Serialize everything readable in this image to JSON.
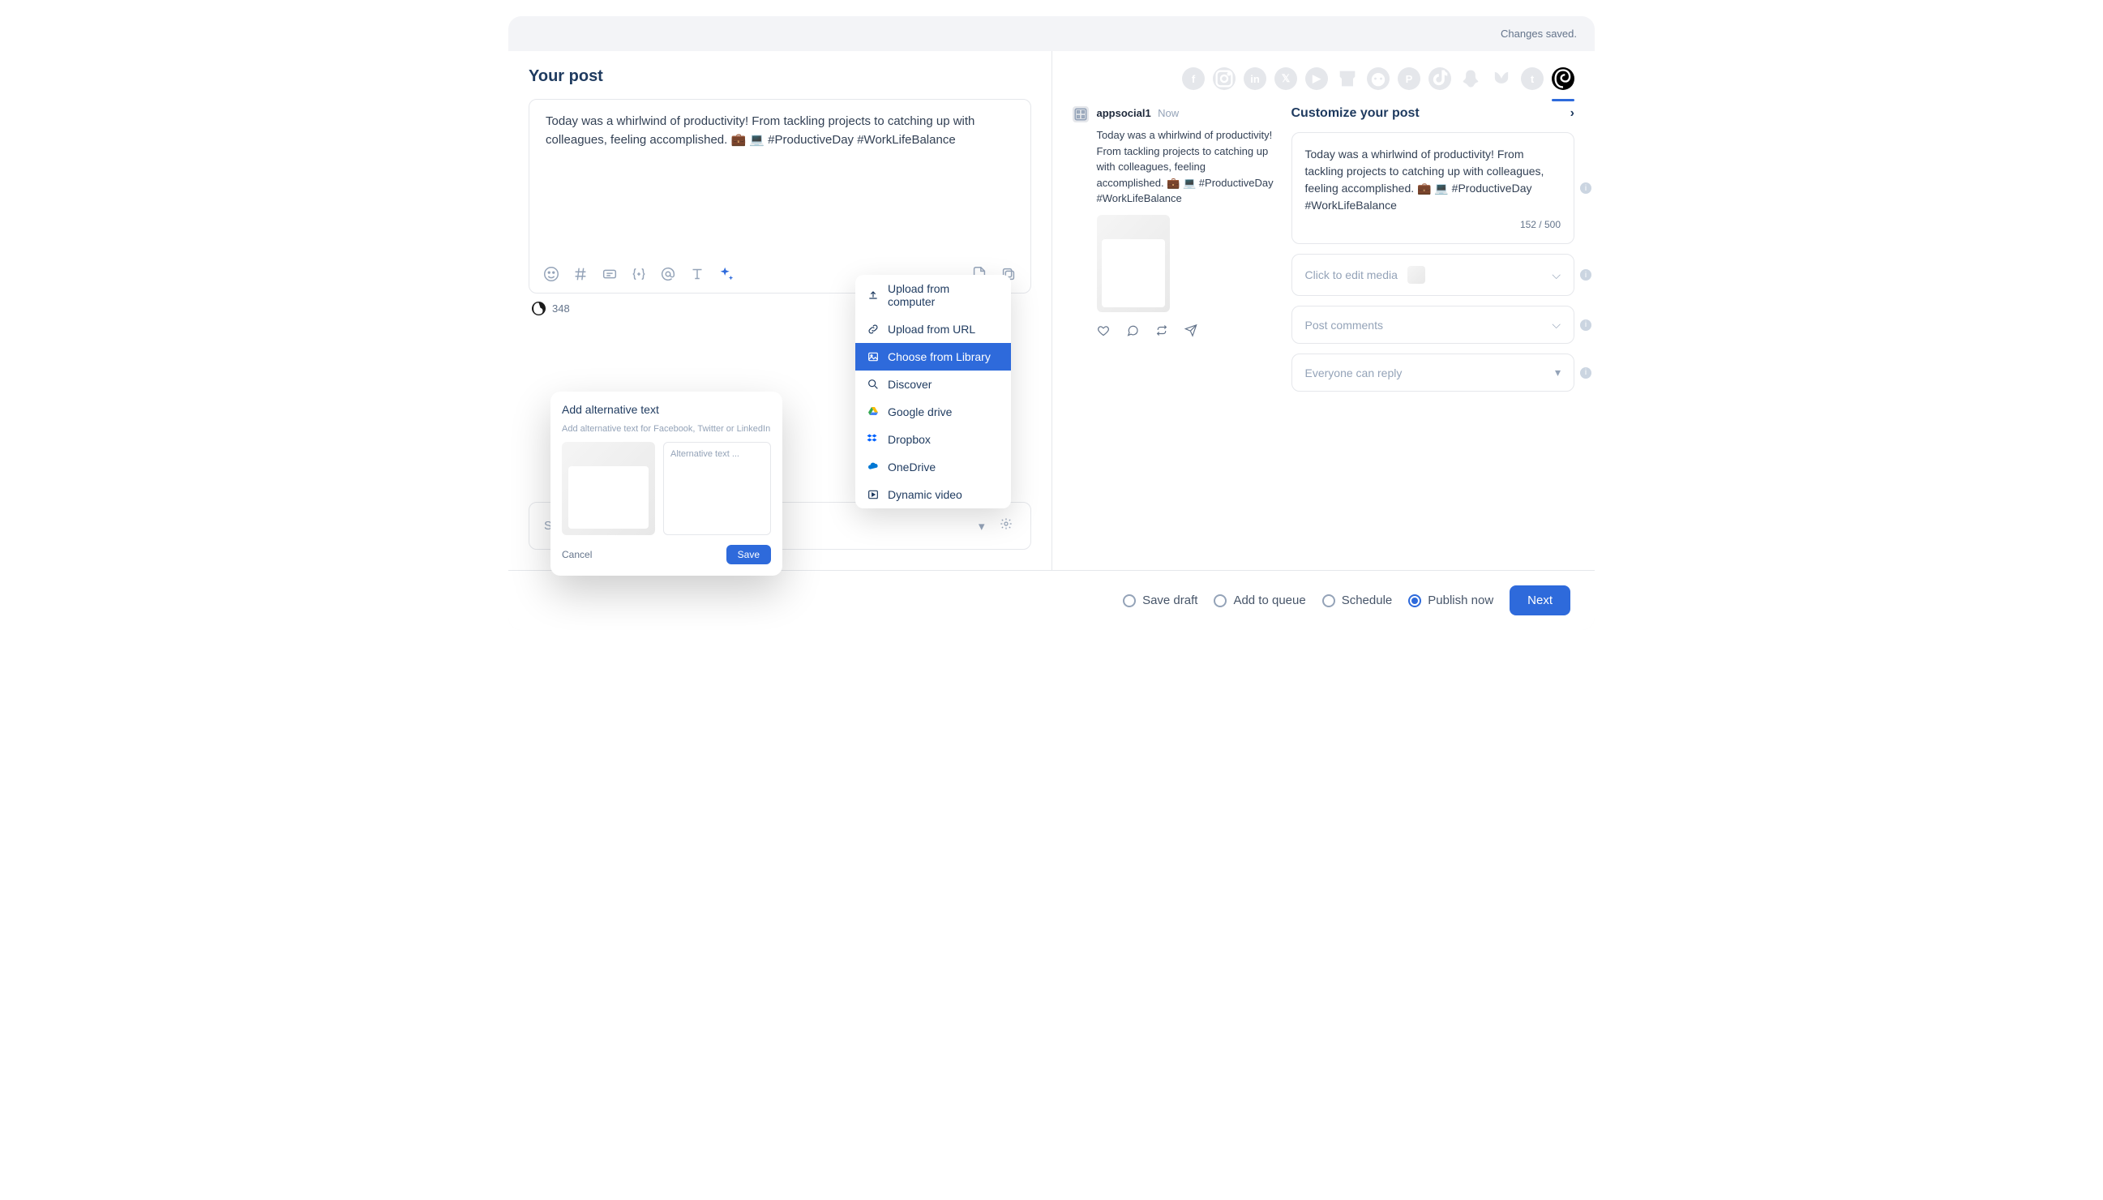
{
  "status": {
    "saved": "Changes saved."
  },
  "left": {
    "title": "Your post",
    "content": "Today was a whirlwind of productivity! From tackling projects to catching up with colleagues, feeling accomplished. 💼 💻 #ProductiveDay #WorkLifeBalance",
    "char_count": "348",
    "labels_placeholder": "Select labels"
  },
  "upload_menu": [
    {
      "label": "Upload from computer",
      "icon": "upload"
    },
    {
      "label": "Upload from URL",
      "icon": "link"
    },
    {
      "label": "Choose from Library",
      "icon": "image",
      "active": true
    },
    {
      "label": "Discover",
      "icon": "search"
    },
    {
      "label": "Google drive",
      "icon": "gdrive"
    },
    {
      "label": "Dropbox",
      "icon": "dropbox"
    },
    {
      "label": "OneDrive",
      "icon": "onedrive"
    },
    {
      "label": "Dynamic video",
      "icon": "video"
    }
  ],
  "alt_dialog": {
    "title": "Add alternative text",
    "hint": "Add alternative text for Facebook, Twitter or LinkedIn",
    "placeholder": "Alternative text ...",
    "cancel": "Cancel",
    "save": "Save"
  },
  "social_networks": [
    "facebook",
    "instagram",
    "linkedin",
    "x",
    "youtube",
    "gmb",
    "reddit",
    "pinterest",
    "tiktok",
    "snapchat",
    "bluesky",
    "tumblr",
    "threads"
  ],
  "preview": {
    "username": "appsocial1",
    "time": "Now",
    "text": "Today was a whirlwind of productivity! From tackling projects to catching up with colleagues, feeling accomplished. 💼 💻 #ProductiveDay #WorkLifeBalance"
  },
  "customize": {
    "title": "Customize your post",
    "text": "Today was a whirlwind of productivity! From tackling projects to catching up with colleagues, feeling accomplished. 💼 💻 #ProductiveDay #WorkLifeBalance",
    "counter": "152 / 500",
    "media_row": "Click to edit media",
    "comments_row": "Post comments",
    "reply_row": "Everyone can reply"
  },
  "footer": {
    "options": [
      "Save draft",
      "Add to queue",
      "Schedule",
      "Publish now"
    ],
    "selected": 3,
    "next": "Next"
  }
}
